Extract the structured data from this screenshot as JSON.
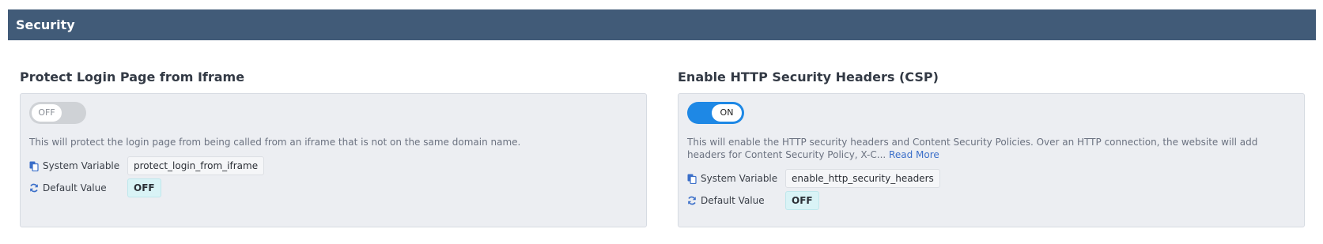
{
  "section": {
    "title": "Security"
  },
  "settings": [
    {
      "title": "Protect Login Page from Iframe",
      "toggle_label": "OFF",
      "description": "This will protect the login page from being called from an iframe that is not on the same domain name.",
      "read_more": "",
      "system_variable_label": "System Variable",
      "system_variable": "protect_login_from_iframe",
      "default_value_label": "Default Value",
      "default_value": "OFF"
    },
    {
      "title": "Enable HTTP Security Headers (CSP)",
      "toggle_label": "ON",
      "description": "This will enable the HTTP security headers and Content Security Policies. Over an HTTP connection, the website will add headers for Content Security Policy, X-C...",
      "read_more": "Read More",
      "system_variable_label": "System Variable",
      "system_variable": "enable_http_security_headers",
      "default_value_label": "Default Value",
      "default_value": "OFF"
    }
  ],
  "icons": {
    "system_variable": "copy-icon",
    "default_value": "refresh-icon"
  },
  "colors": {
    "header_bg": "#415b78",
    "toggle_on": "#1e88e5",
    "toggle_off": "#cfd2d6",
    "link": "#3b6fc9",
    "default_value_bg": "#d9f3f6"
  }
}
